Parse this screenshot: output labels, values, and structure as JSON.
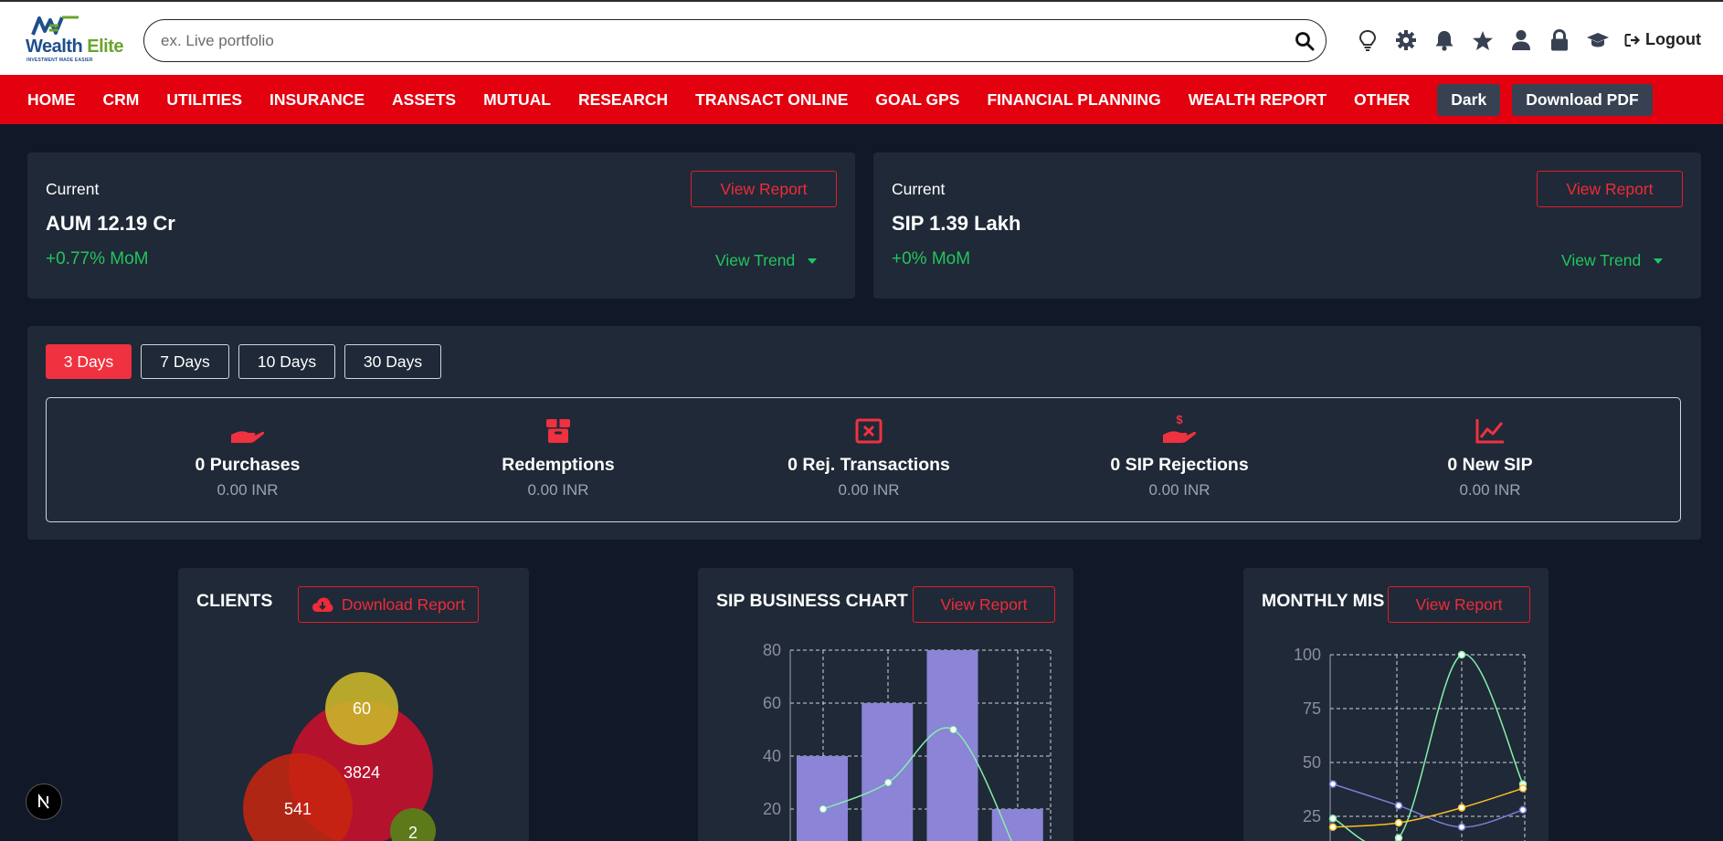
{
  "header": {
    "logo_main": "Wealth ",
    "logo_accent": "Elite",
    "logo_tagline": "INVESTMENT MADE EASIER",
    "search_placeholder": "ex. Live portfolio",
    "icons": [
      "lightbulb-icon",
      "gear-icon",
      "bell-icon",
      "star-icon",
      "user-icon",
      "lock-icon",
      "graduation-cap-icon"
    ],
    "logout_label": "Logout"
  },
  "nav": {
    "items": [
      "HOME",
      "CRM",
      "UTILITIES",
      "INSURANCE",
      "ASSETS",
      "MUTUAL",
      "RESEARCH",
      "TRANSACT ONLINE",
      "GOAL GPS",
      "FINANCIAL PLANNING",
      "WEALTH REPORT",
      "OTHER"
    ],
    "dark_label": "Dark",
    "pdf_label": "Download PDF"
  },
  "aum": {
    "current_label": "Current",
    "value": "AUM 12.19 Cr",
    "change": "+0.77% MoM",
    "report_label": "View Report",
    "trend_label": "View Trend"
  },
  "sip": {
    "current_label": "Current",
    "value": "SIP 1.39 Lakh",
    "change": "+0% MoM",
    "report_label": "View Report",
    "trend_label": "View Trend"
  },
  "periods": {
    "options": [
      "3 Days",
      "7 Days",
      "10 Days",
      "30 Days"
    ],
    "selected": "3 Days"
  },
  "stats": [
    {
      "label": "0 Purchases",
      "amount": "0.00 INR",
      "icon": "hand-icon"
    },
    {
      "label": "Redemptions",
      "amount": "0.00 INR",
      "icon": "box-icon"
    },
    {
      "label": "0 Rej. Transactions",
      "amount": "0.00 INR",
      "icon": "x-square-icon"
    },
    {
      "label": "0 SIP Rejections",
      "amount": "0.00 INR",
      "icon": "hand-dollar-icon"
    },
    {
      "label": "0 New SIP",
      "amount": "0.00 INR",
      "icon": "chart-line-icon"
    }
  ],
  "clients": {
    "title": "CLIENTS",
    "download_label": "Download Report",
    "bubbles": [
      {
        "value": "60",
        "color": "#c8b62a"
      },
      {
        "value": "3824",
        "color": "#b5122e"
      },
      {
        "value": "541",
        "color": "#c9260f"
      },
      {
        "value": "2",
        "color": "#5d7a1a"
      }
    ]
  },
  "sip_business": {
    "title": "SIP BUSINESS CHART",
    "report_label": "View Report"
  },
  "monthly_mis": {
    "title": "MONTHLY MIS",
    "report_label": "View Report"
  },
  "chart_data": [
    {
      "type": "bar",
      "title": "SIP BUSINESS CHART",
      "y_ticks": [
        "80",
        "60",
        "40",
        "20"
      ],
      "ylim": [
        0,
        80
      ],
      "bars": [
        40,
        60,
        80,
        20
      ],
      "bar_color": "#8b84d7",
      "line": [
        20,
        30,
        50,
        2
      ],
      "line_color": "#86efac",
      "grid": true
    },
    {
      "type": "line",
      "title": "MONTHLY MIS",
      "y_ticks": [
        "100",
        "75",
        "50",
        "25"
      ],
      "ylim": [
        0,
        100
      ],
      "series": [
        {
          "values": [
            40,
            30,
            20,
            28
          ],
          "color": "#7c7cd6"
        },
        {
          "values": [
            24,
            15,
            100,
            40
          ],
          "color": "#86efac"
        },
        {
          "values": [
            20,
            22,
            29,
            38
          ],
          "color": "#fbbf24"
        }
      ],
      "grid": true
    }
  ]
}
